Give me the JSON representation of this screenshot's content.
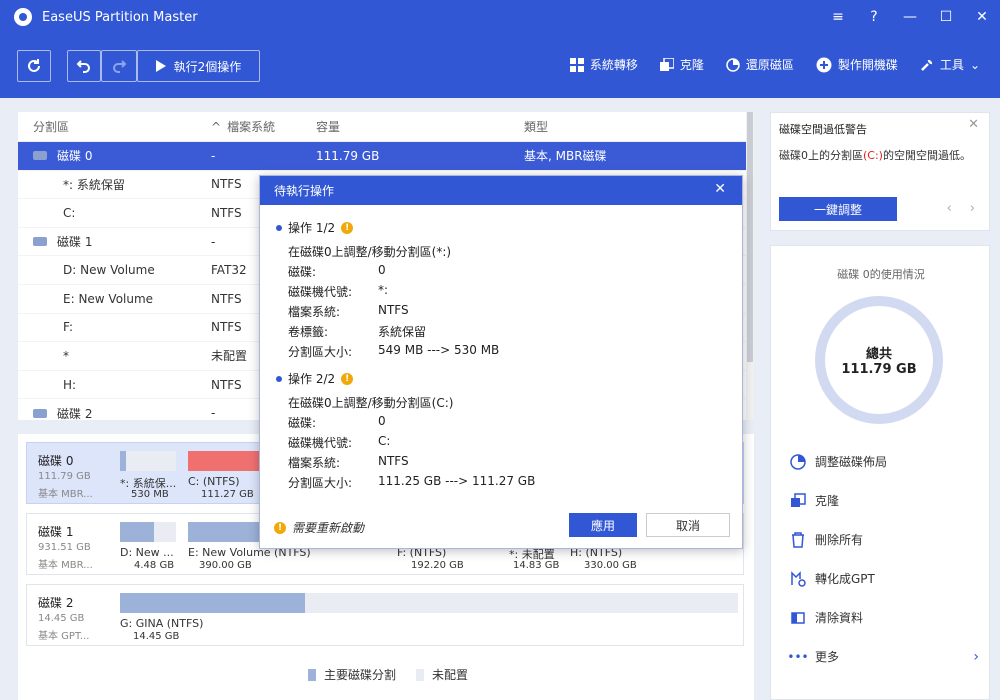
{
  "window": {
    "title": "EaseUS Partition Master"
  },
  "toolbar": {
    "execute_label": "執行2個操作",
    "tools": [
      {
        "label": "系統轉移",
        "icon": "grid-icon"
      },
      {
        "label": "克隆",
        "icon": "clone-icon"
      },
      {
        "label": "還原磁區",
        "icon": "restore-icon"
      },
      {
        "label": "製作開機碟",
        "icon": "plus-circle-icon"
      },
      {
        "label": "工具",
        "icon": "wrench-icon"
      }
    ]
  },
  "partition_table": {
    "headers": {
      "partition": "分割區",
      "filesystem": "檔案系統",
      "capacity": "容量",
      "type": "類型"
    },
    "rows": [
      {
        "name": "磁碟 0",
        "fs": "-",
        "capacity": "111.79 GB",
        "type": "基本, MBR磁碟"
      },
      {
        "name": "*: 系統保留",
        "fs": "NTFS"
      },
      {
        "name": "C:",
        "fs": "NTFS"
      },
      {
        "name": "磁碟 1",
        "fs": "-"
      },
      {
        "name": "D: New Volume",
        "fs": "FAT32"
      },
      {
        "name": "E: New Volume",
        "fs": "NTFS"
      },
      {
        "name": "F:",
        "fs": "NTFS"
      },
      {
        "name": "*",
        "fs": "未配置"
      },
      {
        "name": "H:",
        "fs": "NTFS"
      },
      {
        "name": "磁碟 2",
        "fs": "-"
      }
    ]
  },
  "disk_map": {
    "disk0": {
      "name": "磁碟 0",
      "size": "111.79 GB",
      "type": "基本 MBR...",
      "p1_label": "*: 系統保...",
      "p1_size": "530 MB",
      "p2_label": "C: (NTFS)",
      "p2_size": "111.27 GB"
    },
    "disk1": {
      "name": "磁碟 1",
      "size": "931.51 GB",
      "type": "基本 MBR...",
      "p1_label": "D: New ...",
      "p1_size": "4.48 GB",
      "p2_label": "E: New Volume (NTFS)",
      "p2_size": "390.00 GB",
      "p3_label": "F: (NTFS)",
      "p3_size": "192.20 GB",
      "p4_label": "*: 未配置",
      "p4_size": "14.83 GB",
      "p5_label": "H: (NTFS)",
      "p5_size": "330.00 GB"
    },
    "disk2": {
      "name": "磁碟 2",
      "size": "14.45 GB",
      "type": "基本 GPT...",
      "p1_label": "G: GINA (NTFS)",
      "p1_size": "14.45 GB"
    },
    "legend": {
      "primary": "主要磁碟分割",
      "unallocated": "未配置"
    }
  },
  "side": {
    "warning_title": "磁碟空間過低警告",
    "warning_prefix": "磁碟0上的分割區",
    "warning_drive": "(C:)",
    "warning_suffix": "的空閒空間過低。",
    "adjust_button": "一鍵調整",
    "usage_title": "磁碟 0的使用情況",
    "total_label": "總共",
    "total_value": "111.79 GB",
    "actions": [
      "調整磁碟佈局",
      "克隆",
      "刪除所有",
      "轉化成GPT",
      "清除資料",
      "更多"
    ]
  },
  "modal": {
    "title": "待執行操作",
    "op1": {
      "title": "操作 1/2",
      "desc": "在磁碟0上調整/移動分割區(*:)",
      "rows": [
        {
          "k": "磁碟:",
          "v": "0"
        },
        {
          "k": "磁碟機代號:",
          "v": "*:"
        },
        {
          "k": "檔案系統:",
          "v": "NTFS"
        },
        {
          "k": "卷標籤:",
          "v": "系統保留"
        },
        {
          "k": "分割區大小:",
          "v": "549 MB ---> 530 MB"
        }
      ]
    },
    "op2": {
      "title": "操作 2/2",
      "desc": "在磁碟0上調整/移動分割區(C:)",
      "rows": [
        {
          "k": "磁碟:",
          "v": "0"
        },
        {
          "k": "磁碟機代號:",
          "v": "C:"
        },
        {
          "k": "檔案系統:",
          "v": "NTFS"
        },
        {
          "k": "分割區大小:",
          "v": "111.25 GB ---> 111.27 GB"
        }
      ]
    },
    "reboot_note": "需要重新啟動",
    "apply": "應用",
    "cancel": "取消"
  },
  "colors": {
    "accent": "#3157d5",
    "selected_row": "#3b5bd6",
    "red_partition": "#f07070",
    "warn": "#f0a80a"
  }
}
